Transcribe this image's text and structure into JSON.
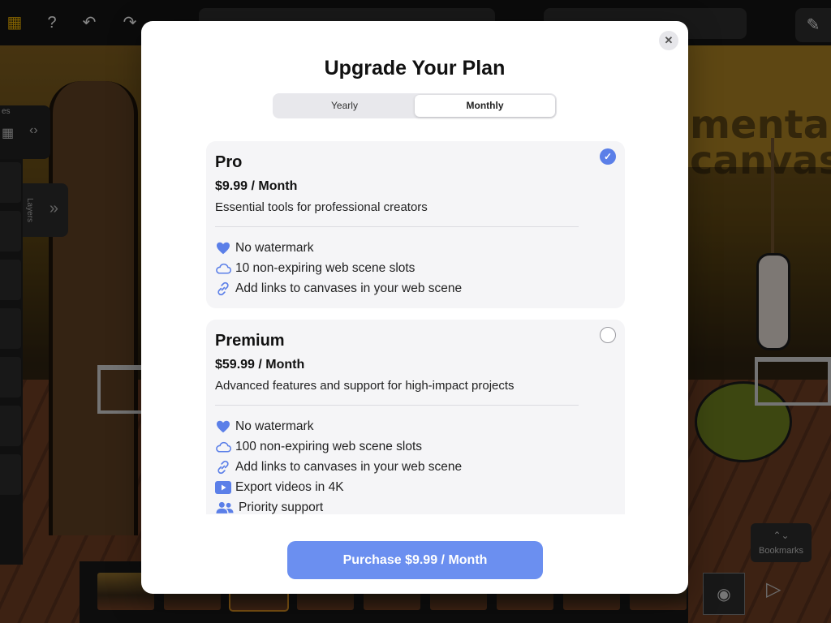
{
  "background_app": {
    "layers_label": "Layers",
    "bookmarks_label": "Bookmarks",
    "bg_text_line1": "mental",
    "bg_text_line2": "canvas",
    "panel_partial_label": "es"
  },
  "modal": {
    "title": "Upgrade Your Plan",
    "close_symbol": "✕",
    "billing_tabs": [
      {
        "label": "Yearly",
        "active": false
      },
      {
        "label": "Monthly",
        "active": true
      }
    ],
    "plans": [
      {
        "name": "Pro",
        "price": "$9.99 / Month",
        "description": "Essential tools for professional creators",
        "selected": true,
        "features": [
          {
            "icon": "heart-icon",
            "label": "No watermark"
          },
          {
            "icon": "cloud-icon",
            "label": "10 non-expiring web scene slots"
          },
          {
            "icon": "link-icon",
            "label": "Add links to canvases in your web scene"
          }
        ]
      },
      {
        "name": "Premium",
        "price": "$59.99 / Month",
        "description": "Advanced features and support for high-impact projects",
        "selected": false,
        "features": [
          {
            "icon": "heart-icon",
            "label": "No watermark"
          },
          {
            "icon": "cloud-icon",
            "label": "100 non-expiring web scene slots"
          },
          {
            "icon": "link-icon",
            "label": "Add links to canvases in your web scene"
          },
          {
            "icon": "video-icon",
            "label": "Export videos in 4K"
          },
          {
            "icon": "people-icon",
            "label": "Priority support"
          }
        ]
      }
    ],
    "purchase_label": "Purchase $9.99 / Month",
    "accent_color": "#5b7fe8",
    "check_symbol": "✓"
  }
}
